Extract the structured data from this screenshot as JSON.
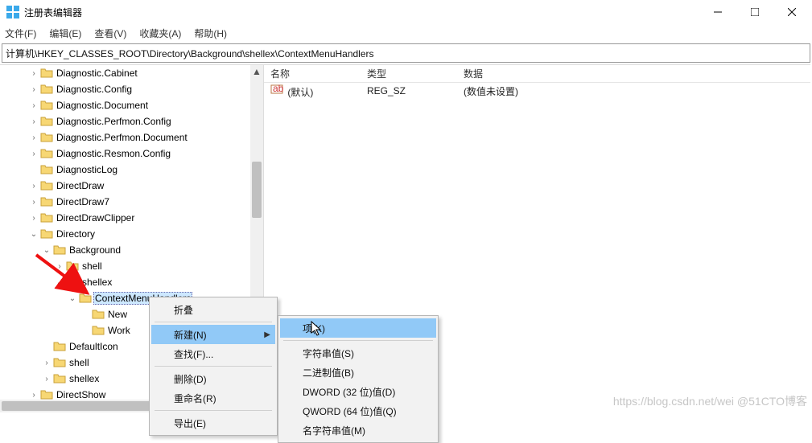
{
  "title": "注册表编辑器",
  "menus": {
    "file": "文件(F)",
    "edit": "编辑(E)",
    "view": "查看(V)",
    "fav": "收藏夹(A)",
    "help": "帮助(H)"
  },
  "address": "计算机\\HKEY_CLASSES_ROOT\\Directory\\Background\\shellex\\ContextMenuHandlers",
  "cols": {
    "name": "名称",
    "type": "类型",
    "data": "数据"
  },
  "value_row": {
    "name": "(默认)",
    "type": "REG_SZ",
    "data": "(数值未设置)"
  },
  "tree": {
    "items": [
      "Diagnostic.Cabinet",
      "Diagnostic.Config",
      "Diagnostic.Document",
      "Diagnostic.Perfmon.Config",
      "Diagnostic.Perfmon.Document",
      "Diagnostic.Resmon.Config",
      "DiagnosticLog",
      "DirectDraw",
      "DirectDraw7",
      "DirectDrawClipper"
    ],
    "directory": "Directory",
    "background": "Background",
    "shell": "shell",
    "shellex": "shellex",
    "cmh": "ContextMenuHandlers",
    "newkey": "New",
    "work": "Work",
    "defaulticon": "DefaultIcon",
    "shell2": "shell",
    "shellex2": "shellex",
    "directshow": "DirectShow"
  },
  "ctx1": {
    "collapse": "折叠",
    "new": "新建(N)",
    "find": "查找(F)...",
    "delete": "删除(D)",
    "rename": "重命名(R)",
    "export": "导出(E)"
  },
  "ctx2": {
    "key": "项(K)",
    "string": "字符串值(S)",
    "binary": "二进制值(B)",
    "dword": "DWORD (32 位)值(D)",
    "qword": "QWORD (64 位)值(Q)",
    "expand": "名字符串值(M)"
  },
  "watermark": "https://blog.csdn.net/wei @51CTO博客"
}
